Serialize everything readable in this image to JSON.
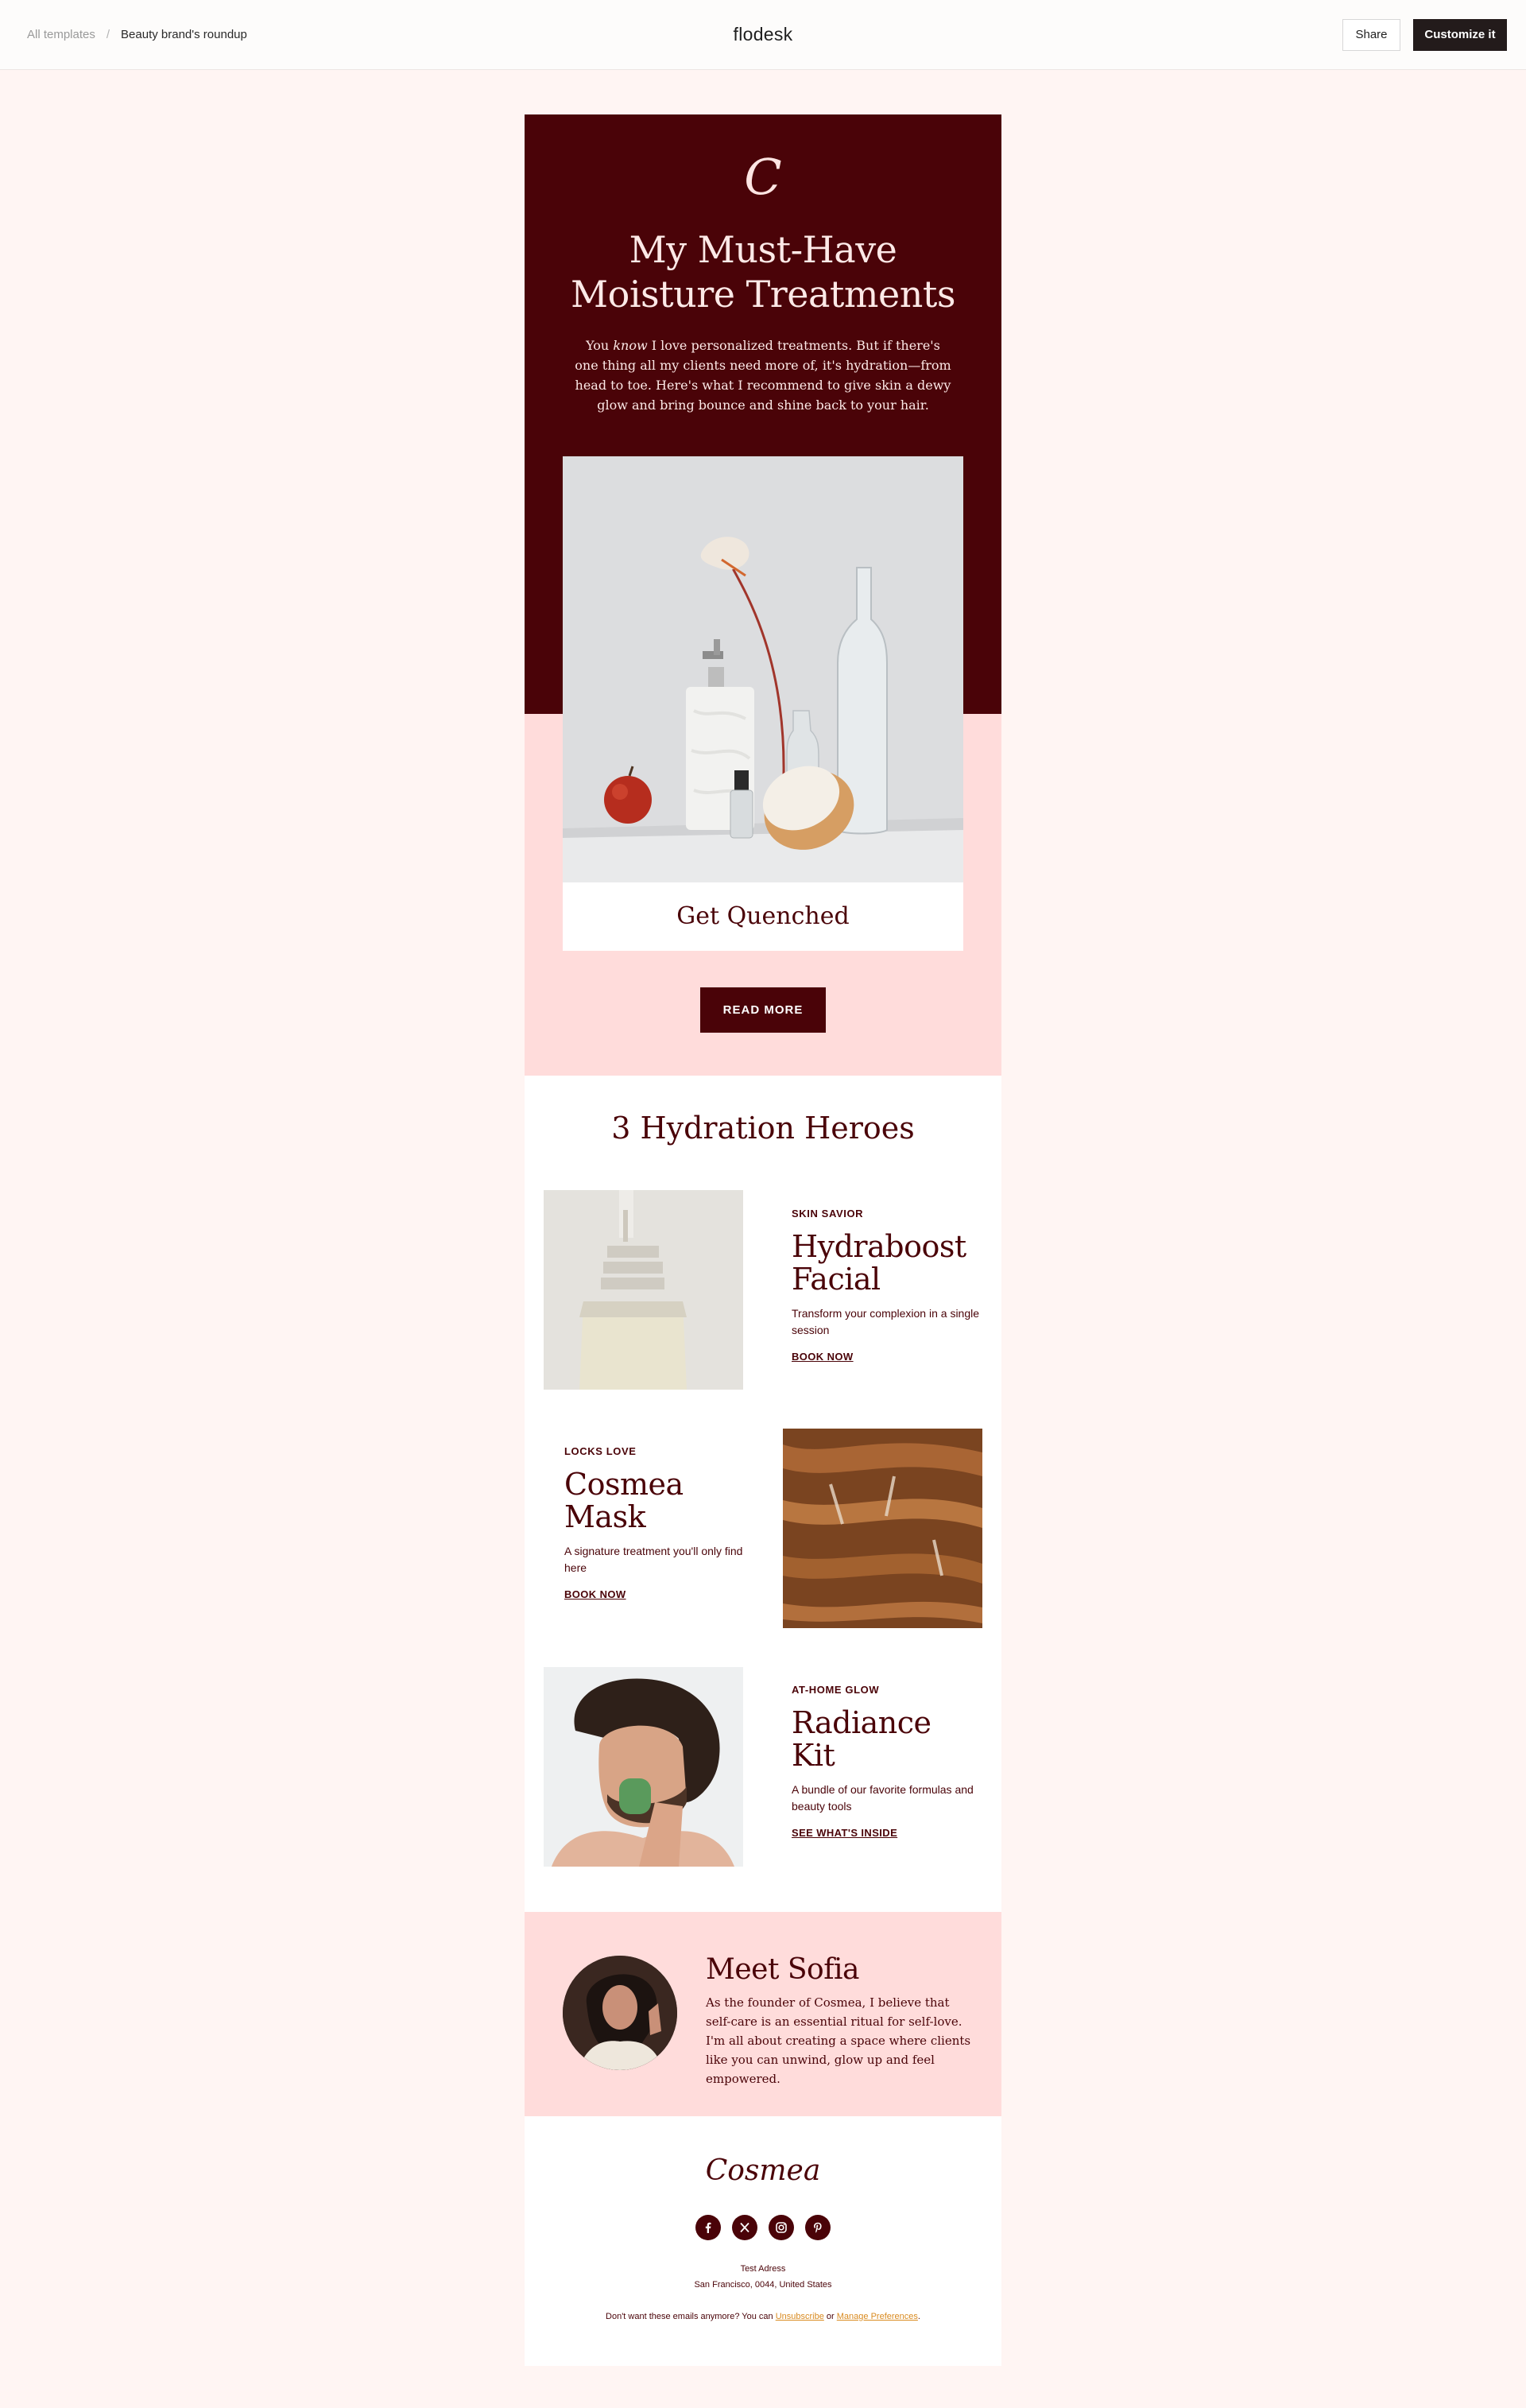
{
  "topbar": {
    "breadcrumb_root": "All templates",
    "breadcrumb_sep": "/",
    "breadcrumb_current": "Beauty brand's roundup",
    "logo": "flodesk",
    "share_label": "Share",
    "customize_label": "Customize it"
  },
  "hero": {
    "monogram": "C",
    "title": "My Must-Have Moisture Treatments",
    "intro_pre": "You ",
    "intro_em": "know",
    "intro_post": " I love personalized treatments. But if there's one thing all my clients need more of, it's hydration—from head to toe. Here's what I recommend to give skin a dewy glow and bring bounce and shine back to your hair.",
    "caption": "Get Quenched",
    "cta": "READ MORE"
  },
  "heroes": {
    "title": "3 Hydration Heroes",
    "products": [
      {
        "eyebrow": "SKIN SAVIOR",
        "name": "Hydraboost Facial",
        "desc": "Transform your complexion in a single session",
        "link": "BOOK NOW"
      },
      {
        "eyebrow": "LOCKS LOVE",
        "name": "Cosmea Mask",
        "desc": "A signature treatment you'll only find here",
        "link": "BOOK NOW"
      },
      {
        "eyebrow": "AT-HOME GLOW",
        "name": "Radiance Kit",
        "desc": "A bundle of our favorite formulas and beauty tools",
        "link": "SEE WHAT'S INSIDE"
      }
    ]
  },
  "founder": {
    "title": "Meet Sofia",
    "bio": "As the founder of Cosmea, I believe that self-care is an essential ritual for self-love. I'm all about creating a space where clients like you can unwind, glow up and feel empowered."
  },
  "footer": {
    "logo": "Cosmea",
    "socials": [
      "facebook-icon",
      "x-icon",
      "instagram-icon",
      "pinterest-icon"
    ],
    "address_line1": "Test Adress",
    "address_line2": "San Francisco, 0044, United States",
    "unsub_pre": "Don't want these emails anymore? You can ",
    "unsub_link": "Unsubscribe",
    "unsub_mid": " or ",
    "prefs_link": "Manage Preferences",
    "unsub_end": "."
  },
  "colors": {
    "page_bg": "#fff5f3",
    "brand_dark": "#4a0308",
    "brand_pink": "#ffdcdb",
    "link_orange": "#d98a1f"
  }
}
